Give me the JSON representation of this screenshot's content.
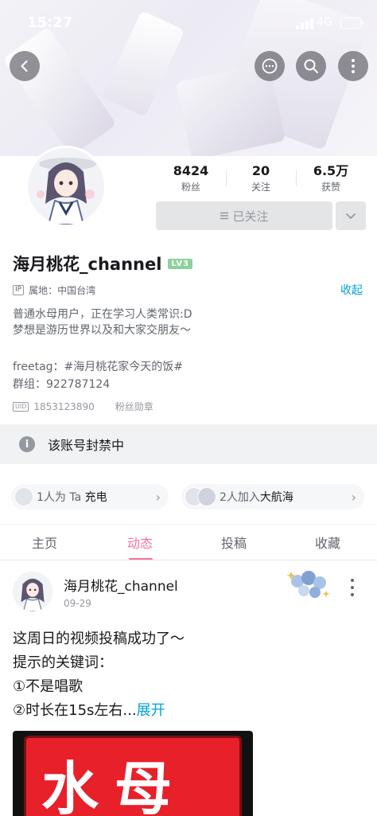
{
  "status_bar": {
    "time": "15:27",
    "network": "4G"
  },
  "profile": {
    "stats": [
      {
        "value": "8424",
        "label": "粉丝"
      },
      {
        "value": "20",
        "label": "关注"
      },
      {
        "value": "6.5万",
        "label": "获赞"
      }
    ],
    "follow_label": "已关注",
    "name": "海月桃花_channel",
    "level": "LV3",
    "ip_tag": "IP",
    "ip_location": "属地：中国台湾",
    "collapse_label": "收起",
    "bio_line1": "普通水母用户，正在学习人类常识:D",
    "bio_line2": "梦想是游历世界以及和大家交朋友～",
    "freetag": "freetag：#海月桃花家今天的饭#",
    "group": "群组：922787124",
    "uid_tag": "UID",
    "uid": "1853123890",
    "medal_label": "粉丝勋章"
  },
  "banned_notice": "该账号封禁中",
  "charge_pill": {
    "count_text": "1人为 Ta ",
    "action": "充电"
  },
  "fleet_pill": {
    "count_text": "2人加入",
    "action": "大航海"
  },
  "tabs": [
    "主页",
    "动态",
    "投稿",
    "收藏"
  ],
  "active_tab": "动态",
  "post": {
    "author": "海月桃花_channel",
    "date": "09-29",
    "lines": [
      "这周日的视频投稿成功了～",
      "提示的关键词：",
      "①不是唱歌",
      "②时长在15s左右..."
    ],
    "expand_label": "展开",
    "image_text": "水母"
  },
  "colors": {
    "accent_pink": "#fb7299",
    "link_blue": "#00a1d6",
    "level_green": "#8bd29b"
  }
}
